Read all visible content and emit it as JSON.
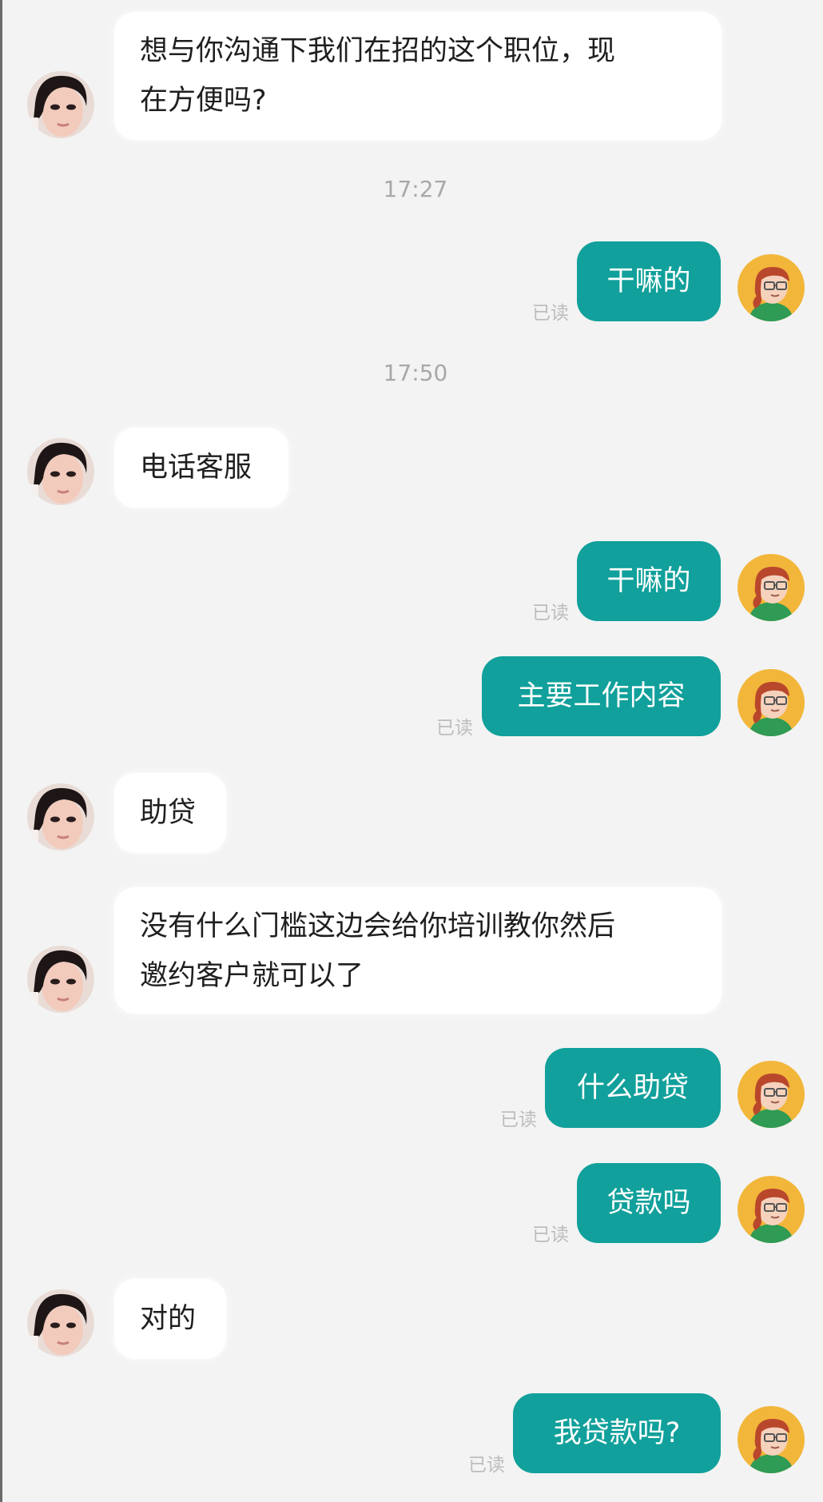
{
  "colors": {
    "background": "#f3f3f3",
    "outgoing_bubble": "#11a09b",
    "incoming_bubble": "#ffffff",
    "read_label": "#bdbdbd",
    "timestamp": "#a8a8a8"
  },
  "messages": [
    {
      "from": "other",
      "text": "想与你沟通下我们在招的这个职位，现在方便吗?",
      "line1": "想与你沟通下我们在招的这个职位，现",
      "line2": "在方便吗?"
    },
    {
      "type": "timestamp",
      "text": "17:27"
    },
    {
      "from": "me",
      "text": "干嘛的",
      "read": "已读"
    },
    {
      "type": "timestamp",
      "text": "17:50"
    },
    {
      "from": "other",
      "text": "电话客服"
    },
    {
      "from": "me",
      "text": "干嘛的",
      "read": "已读"
    },
    {
      "from": "me",
      "text": "主要工作内容",
      "read": "已读"
    },
    {
      "from": "other",
      "text": "助贷"
    },
    {
      "from": "other",
      "text": "没有什么门槛这边会给你培训教你然后邀约客户就可以了",
      "line1": "没有什么门槛这边会给你培训教你然后",
      "line2": "邀约客户就可以了"
    },
    {
      "from": "me",
      "text": "什么助贷",
      "read": "已读"
    },
    {
      "from": "me",
      "text": "贷款吗",
      "read": "已读"
    },
    {
      "from": "other",
      "text": "对的"
    },
    {
      "from": "me",
      "text": "我贷款吗?",
      "read": "已读"
    }
  ]
}
